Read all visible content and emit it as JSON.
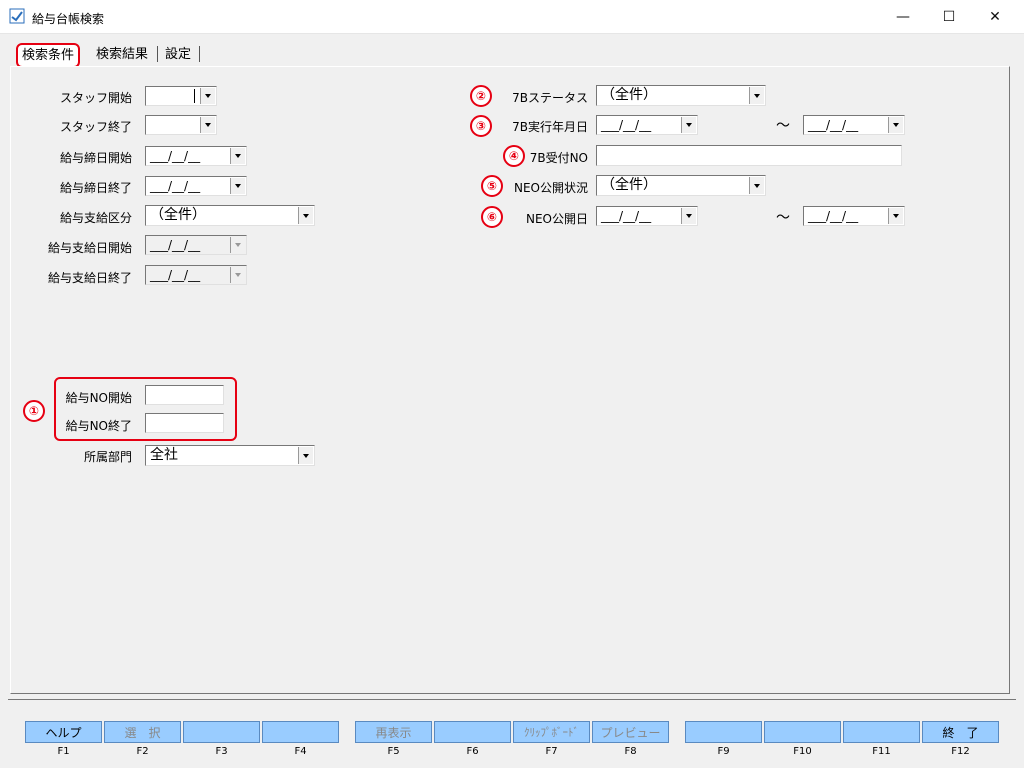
{
  "window": {
    "title": "給与台帳検索",
    "minimize": "—",
    "maximize": "☐",
    "close": "✕"
  },
  "tabs": [
    "検索条件",
    "検索結果",
    "設定"
  ],
  "left_form": {
    "staff_start": "スタッフ開始",
    "staff_end": "スタッフ終了",
    "cutoff_start": "給与締日開始",
    "cutoff_end": "給与締日終了",
    "pay_type": "給与支給区分",
    "pay_type_value": "（全件）",
    "pay_date_start": "給与支給日開始",
    "pay_date_end": "給与支給日終了",
    "payno_start": "給与NO開始",
    "payno_end": "給与NO終了",
    "dept": "所属部門",
    "dept_value": "全社",
    "date_placeholder": "___/__/__"
  },
  "right_form": {
    "status_7b": "7Bステータス",
    "status_7b_value": "（全件）",
    "exec_date_7b": "7B実行年月日",
    "receipt_no_7b": "7B受付NO",
    "neo_status": "NEO公開状況",
    "neo_status_value": "（全件）",
    "neo_date": "NEO公開日",
    "tilde": "～"
  },
  "markers": [
    "①",
    "②",
    "③",
    "④",
    "⑤",
    "⑥"
  ],
  "fkeys": [
    {
      "label": "ヘルプ",
      "key": "F1"
    },
    {
      "label": "選　択",
      "key": "F2"
    },
    {
      "label": "",
      "key": "F3"
    },
    {
      "label": "",
      "key": "F4"
    },
    {
      "label": "再表示",
      "key": "F5"
    },
    {
      "label": "",
      "key": "F6"
    },
    {
      "label": "ｸﾘｯﾌﾟﾎﾞｰﾄﾞ",
      "key": "F7"
    },
    {
      "label": "プレビュー",
      "key": "F8"
    },
    {
      "label": "",
      "key": "F9"
    },
    {
      "label": "",
      "key": "F10"
    },
    {
      "label": "",
      "key": "F11"
    },
    {
      "label": "終　了",
      "key": "F12"
    }
  ],
  "colors": {
    "accent_red": "#e60012",
    "fkey_blue": "#99ccff"
  }
}
